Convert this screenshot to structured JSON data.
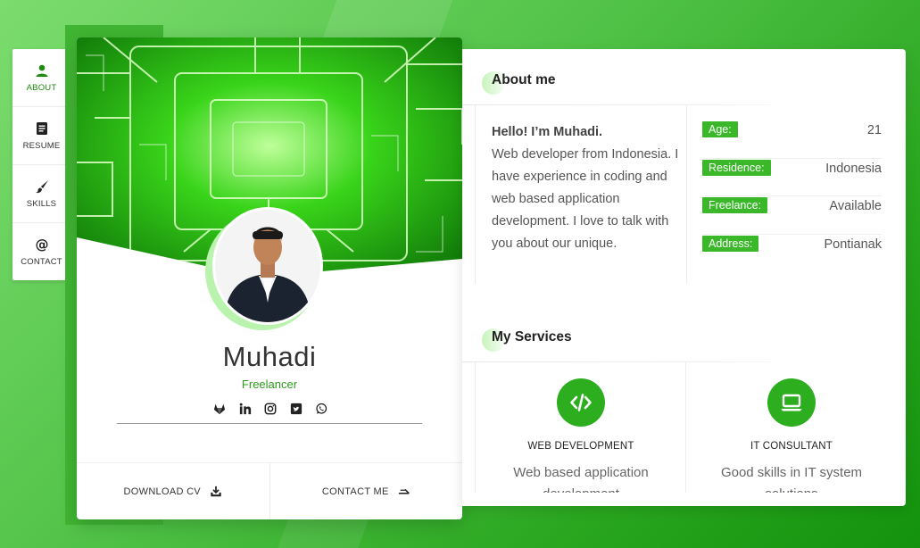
{
  "nav": {
    "items": [
      {
        "label": "ABOUT",
        "icon": "person-icon",
        "active": true
      },
      {
        "label": "RESUME",
        "icon": "document-icon",
        "active": false
      },
      {
        "label": "SKILLS",
        "icon": "brush-icon",
        "active": false
      },
      {
        "label": "CONTACT",
        "icon": "at-icon",
        "active": false
      }
    ]
  },
  "profile": {
    "name": "Muhadi",
    "role": "Freelancer",
    "socials": [
      "gitlab-icon",
      "linkedin-icon",
      "instagram-icon",
      "twitter-icon",
      "whatsapp-icon"
    ],
    "download_cv_label": "DOWNLOAD CV",
    "contact_me_label": "CONTACT ME"
  },
  "about": {
    "title": "About me",
    "greeting": "Hello! I’m Muhadi.",
    "bio": "Web developer from Indonesia. I have experience in coding and web based application development. I love to talk with you about our unique.",
    "info": [
      {
        "key": "Age:",
        "value": "21"
      },
      {
        "key": "Residence:",
        "value": "Indonesia"
      },
      {
        "key": "Freelance:",
        "value": "Available"
      },
      {
        "key": "Address:",
        "value": "Pontianak"
      }
    ]
  },
  "services": {
    "title": "My Services",
    "items": [
      {
        "icon": "code-icon",
        "title": "WEB DEVELOPMENT",
        "desc": "Web based application development"
      },
      {
        "icon": "laptop-icon",
        "title": "IT CONSULTANT",
        "desc": "Good skills in IT system solutions"
      }
    ]
  },
  "colors": {
    "accent": "#2cae1f",
    "background": "#4ec145"
  }
}
